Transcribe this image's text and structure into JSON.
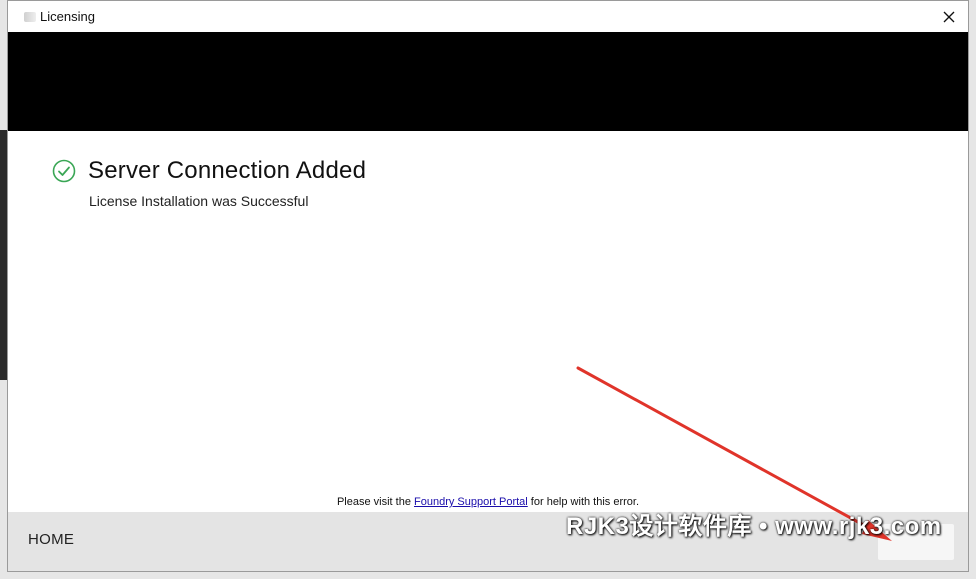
{
  "window": {
    "title": "Licensing",
    "close_glyph": "✕"
  },
  "status": {
    "icon": "check-circle-icon",
    "heading": "Server Connection Added",
    "subtext": "License Installation was Successful"
  },
  "help": {
    "prefix": "Please visit the ",
    "link_text": "Foundry Support Portal",
    "suffix": " for help with this error."
  },
  "footer": {
    "home_label": "HOME"
  },
  "overlay": {
    "watermark": "RJK3设计软件库 • www.rjk3.com",
    "arrow_color": "#e0342a"
  },
  "colors": {
    "banner": "#000000",
    "success_green": "#3aa655",
    "footer_bg": "#e4e4e4",
    "link": "#1a0dab"
  }
}
